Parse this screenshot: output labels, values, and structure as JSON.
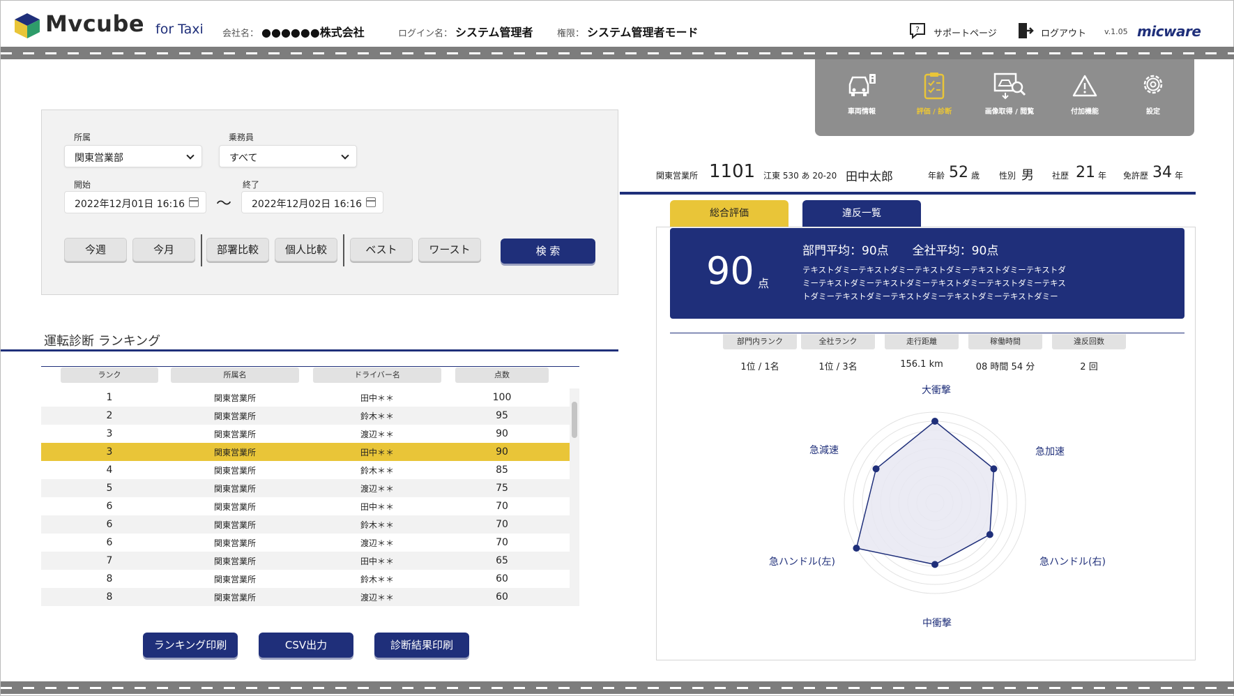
{
  "header": {
    "brand": "Mvcube",
    "brand_sub": "for Taxi",
    "company_label": "会社名：",
    "company_value": "●●●●●●株式会社",
    "login_label": "ログイン名：",
    "login_value": "システム管理者",
    "role_label": "権限：",
    "role_value": "システム管理者モード",
    "support_link": "サポートページ",
    "logout_link": "ログアウト",
    "version": "v.1.05",
    "vendor_logo": "micware"
  },
  "nav": {
    "items": [
      {
        "label": "車両情報",
        "icon": "vehicle-info-icon"
      },
      {
        "label": "評価 / 診断",
        "icon": "clipboard-check-icon",
        "active": true
      },
      {
        "label": "画像取得 / 閲覧",
        "icon": "image-search-icon"
      },
      {
        "label": "付加機能",
        "icon": "warning-icon"
      },
      {
        "label": "設定",
        "icon": "gear-icon"
      }
    ]
  },
  "filter": {
    "affiliation_label": "所属",
    "affiliation_value": "関東営業部",
    "crew_label": "乗務員",
    "crew_value": "すべて",
    "start_label": "開始",
    "start_value": "2022年12月01日 16:16",
    "end_label": "終了",
    "end_value": "2022年12月02日 16:16",
    "range_separator": "〜",
    "buttons": {
      "this_week": "今週",
      "this_month": "今月",
      "dept_compare": "部署比較",
      "individual_compare": "個人比較",
      "best": "ベスト",
      "worst": "ワースト",
      "search": "検 索"
    }
  },
  "ranking": {
    "title": "運転診断 ランキング",
    "columns": [
      "ランク",
      "所属名",
      "ドライバー名",
      "点数"
    ],
    "rows": [
      {
        "rank": "1",
        "office": "関東営業所",
        "driver": "田中＊＊",
        "score": "100"
      },
      {
        "rank": "2",
        "office": "関東営業所",
        "driver": "鈴木＊＊",
        "score": "95"
      },
      {
        "rank": "3",
        "office": "関東営業所",
        "driver": "渡辺＊＊",
        "score": "90"
      },
      {
        "rank": "3",
        "office": "関東営業所",
        "driver": "田中＊＊",
        "score": "90"
      },
      {
        "rank": "4",
        "office": "関東営業所",
        "driver": "鈴木＊＊",
        "score": "85"
      },
      {
        "rank": "5",
        "office": "関東営業所",
        "driver": "渡辺＊＊",
        "score": "75"
      },
      {
        "rank": "6",
        "office": "関東営業所",
        "driver": "田中＊＊",
        "score": "70"
      },
      {
        "rank": "6",
        "office": "関東営業所",
        "driver": "鈴木＊＊",
        "score": "70"
      },
      {
        "rank": "6",
        "office": "関東営業所",
        "driver": "渡辺＊＊",
        "score": "70"
      },
      {
        "rank": "7",
        "office": "関東営業所",
        "driver": "田中＊＊",
        "score": "65"
      },
      {
        "rank": "8",
        "office": "関東営業所",
        "driver": "鈴木＊＊",
        "score": "60"
      },
      {
        "rank": "8",
        "office": "関東営業所",
        "driver": "渡辺＊＊",
        "score": "60"
      }
    ],
    "selected_row": 3,
    "buttons": {
      "print_ranking": "ランキング印刷",
      "csv": "CSV出力",
      "print_result": "診断結果印刷"
    }
  },
  "driver": {
    "office": "関東営業所",
    "car_no": "1101",
    "plate": "江東 530 あ 20-20",
    "name": "田中太郎",
    "age_label": "年齢",
    "age": "52",
    "age_unit": "歳",
    "gender_label": "性別",
    "gender": "男",
    "tenure_label": "社歴",
    "tenure": "21",
    "tenure_unit": "年",
    "license_label": "免許歴",
    "license": "34",
    "license_unit": "年"
  },
  "tabs": {
    "overall": "総合評価",
    "violations": "違反一覧"
  },
  "score": {
    "value": "90",
    "unit": "点",
    "averages": "部門平均：90点　　全社平均：90点",
    "text_line1": "テキストダミーテキストダミーテキストダミーテキストダミーテキストダ",
    "text_line2": "ミーテキストダミーテキストダミーテキストダミーテキストダミーテキス",
    "text_line3": "トダミーテキストダミーテキストダミーテキストダミーテキストダミー"
  },
  "stats": [
    {
      "label": "部門内ランク",
      "value": "1位 / 1名"
    },
    {
      "label": "全社ランク",
      "value": "1位 / 3名"
    },
    {
      "label": "走行距離",
      "value": "156.1 km"
    },
    {
      "label": "稼働時間",
      "value": "08 時間 54 分"
    },
    {
      "label": "違反回数",
      "value": "2 回"
    }
  ],
  "radar": {
    "axes": [
      "大衝撃",
      "急加速",
      "急ハンドル(右)",
      "中衝撃",
      "急ハンドル(左)",
      "急減速"
    ],
    "values": [
      0.9,
      0.75,
      0.7,
      0.68,
      1.0,
      0.75
    ],
    "color": "#1f2f7a",
    "fill": "#e8e8f2"
  },
  "colors": {
    "navy": "#1f2f7a",
    "yellow": "#e9c538",
    "gray_nav": "#8e8e8e"
  }
}
